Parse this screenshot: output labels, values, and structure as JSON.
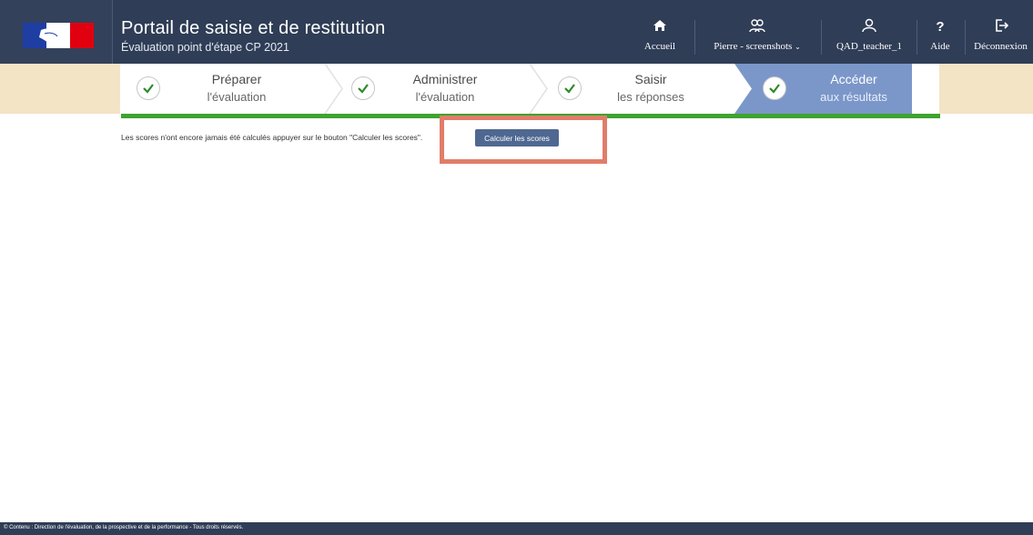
{
  "header": {
    "title": "Portail de saisie et de restitution",
    "subtitle": "Évaluation point d'étape CP 2021",
    "nav": {
      "home_label": "Accueil",
      "school_label": "Pierre - screenshots",
      "user_label": "QAD_teacher_1",
      "help_label": "Aide",
      "logout_label": "Déconnexion"
    }
  },
  "stepper": {
    "steps": [
      {
        "line1": "Préparer",
        "line2": "l'évaluation",
        "state": "done"
      },
      {
        "line1": "Administrer",
        "line2": "l'évaluation",
        "state": "done"
      },
      {
        "line1": "Saisir",
        "line2": "les réponses",
        "state": "done"
      },
      {
        "line1": "Accéder",
        "line2": "aux résultats",
        "state": "active"
      }
    ],
    "colors": {
      "band": "#f4e4c6",
      "active": "#7b97c9",
      "progress": "#3ea32e"
    }
  },
  "content": {
    "message": "Les scores n'ont encore jamais été calculés appuyer sur le bouton \"Calculer les scores\".",
    "button_label": "Calculer les scores"
  },
  "footer": {
    "text": "© Contenu : Direction de l'évaluation, de la prospective et de la performance - Tous droits réservés."
  },
  "colors": {
    "header": "#2f3d56",
    "button": "#4f6891",
    "highlight": "#e07d6a"
  }
}
